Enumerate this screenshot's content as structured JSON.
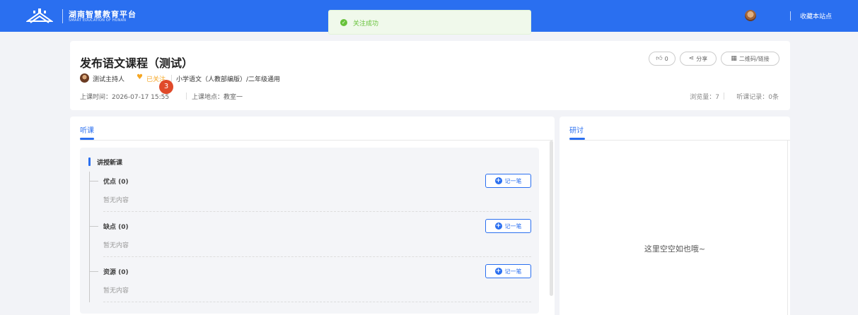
{
  "header": {
    "site_title": "湖南智慧教育平台",
    "site_subtitle": "SMART EDUCATION OF HUNAN",
    "favorite_link": "收藏本站点",
    "brand_color": "#2a6ff0"
  },
  "toast": {
    "message": "关注成功",
    "icon": "check-circle-icon"
  },
  "course": {
    "title": "发布语文课程（测试）",
    "host": "测试主持人",
    "follow_status": "已关注",
    "subject": "小学语文（人教部编版）/二年级通用",
    "time_text": "上课时间：2026-07-17 15:55",
    "place_text": "上课地点：教室一",
    "views_text": "浏览量：7",
    "records_text": "听课记录：0条",
    "notification_badge": "3",
    "actions": {
      "like": "0",
      "share": "分享",
      "qr": "二维码/链接"
    }
  },
  "left_panel": {
    "tab": "听课",
    "section_title": "讲授新课",
    "items": [
      {
        "label": "优点 (0)",
        "empty": "暂无内容",
        "button": "记一笔"
      },
      {
        "label": "缺点 (0)",
        "empty": "暂无内容",
        "button": "记一笔"
      },
      {
        "label": "资源 (0)",
        "empty": "暂无内容",
        "button": "记一笔"
      }
    ]
  },
  "right_panel": {
    "tab": "研讨",
    "empty_message": "这里空空如也哦~"
  }
}
